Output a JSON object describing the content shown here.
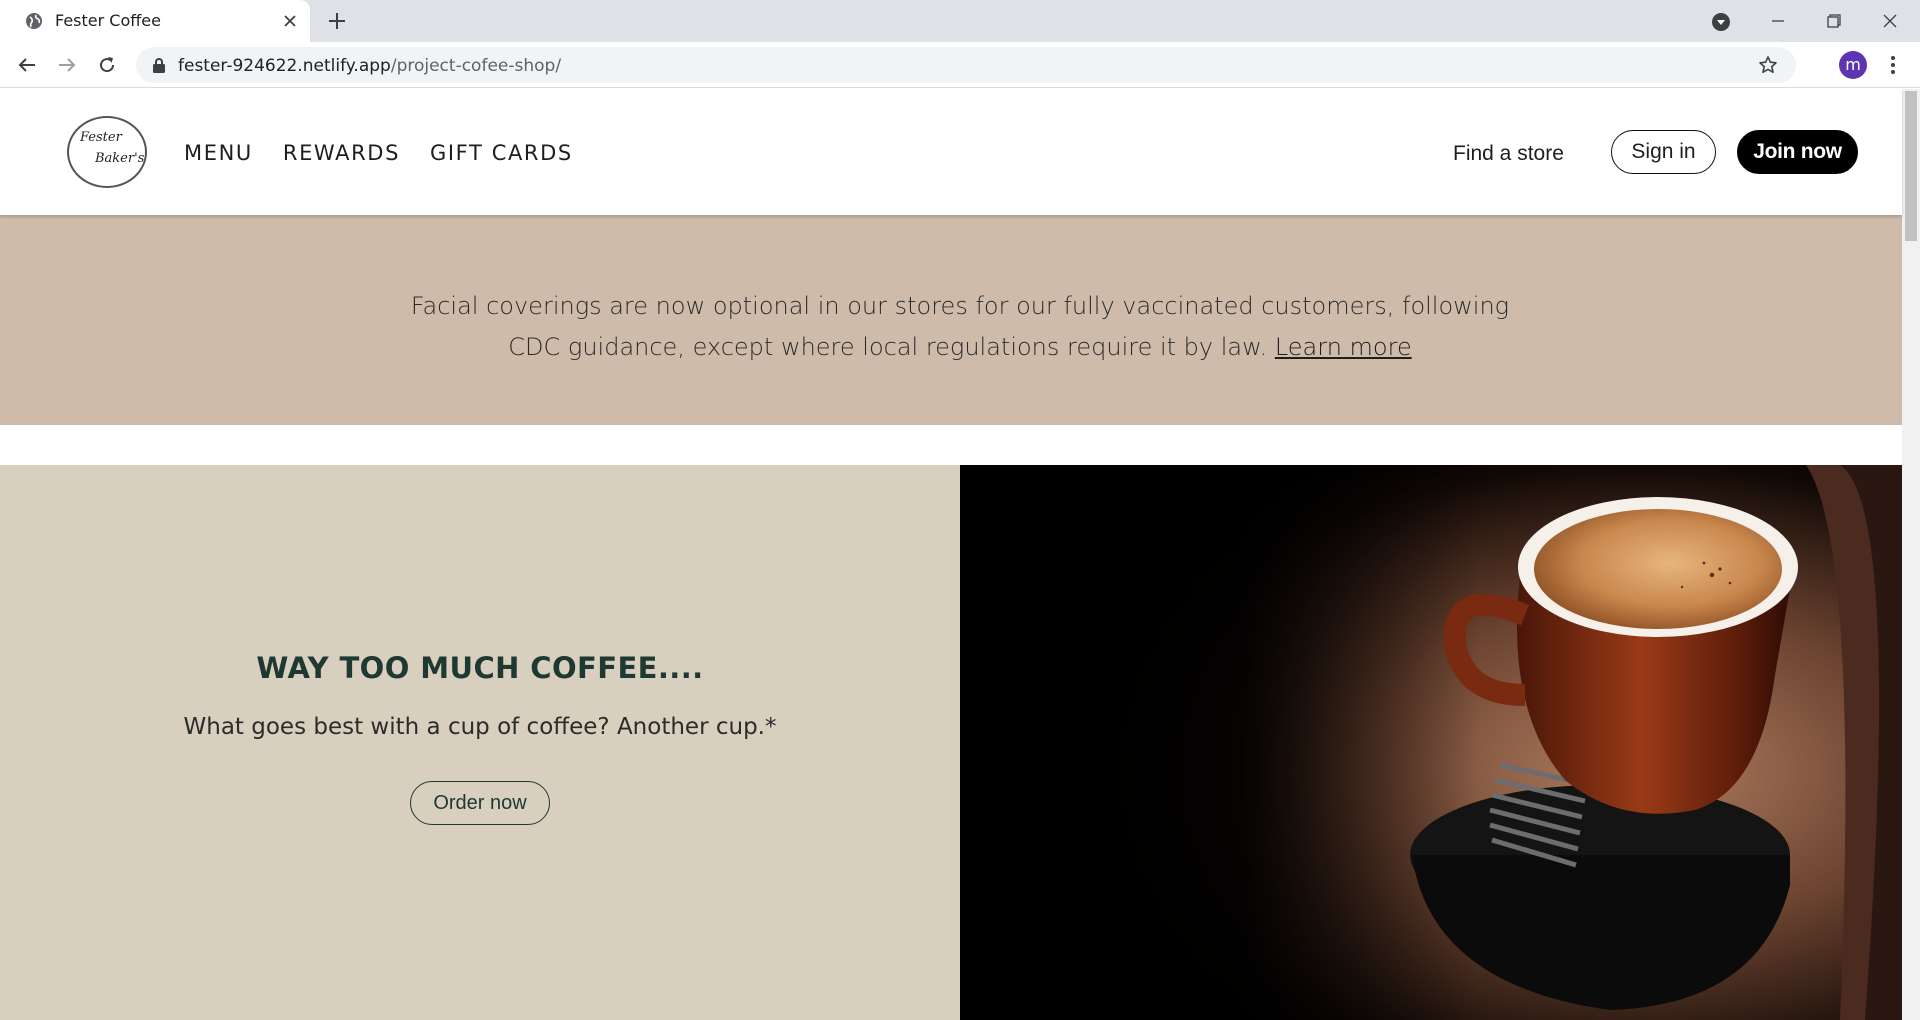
{
  "browser": {
    "tab_title": "Fester Coffee",
    "url_host": "fester-924622.netlify.app",
    "url_path": "/project-cofee-shop/",
    "avatar_letter": "m"
  },
  "header": {
    "logo_line1": "Fester",
    "logo_line2": "Baker's",
    "nav": [
      "MENU",
      "REWARDS",
      "GIFT CARDS"
    ],
    "find_store": "Find a store",
    "sign_in": "Sign in",
    "join_now": "Join now"
  },
  "notice": {
    "text": "Facial coverings are now optional in our stores for our fully vaccinated customers, following CDC guidance, except where local regulations require it by law.",
    "link": "Learn more"
  },
  "hero": {
    "title": "WAY TOO MUCH COFFEE....",
    "subtitle": "What goes best with a cup of coffee? Another cup.*",
    "button": "Order now"
  },
  "colors": {
    "notice_bg": "#cebbaa",
    "hero_bg": "#d9cfbf",
    "brand_green": "#1e3932",
    "avatar": "#5e35b1"
  }
}
